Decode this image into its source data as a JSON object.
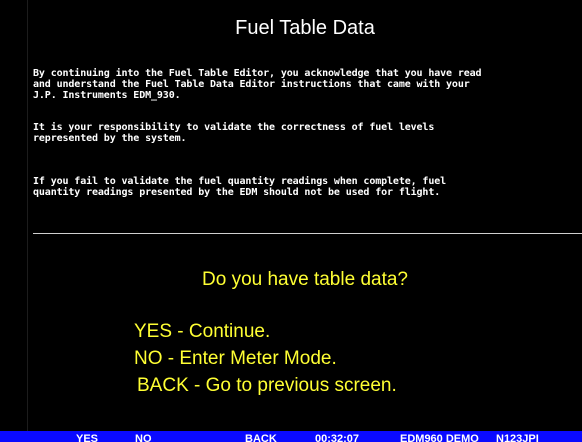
{
  "screen": {
    "title": "Fuel Table Data",
    "paragraphs": [
      "By continuing into the Fuel Table Editor, you acknowledge that you have read\nand understand the Fuel Table Data Editor instructions that came with your\nJ.P. Instruments EDM_930.",
      "It is your responsibility to validate the correctness of fuel levels\nrepresented by the system.",
      "If you fail to validate the fuel quantity readings when complete, fuel\nquantity readings presented by the EDM should not be used for flight."
    ],
    "question": "Do you have table data?",
    "options": [
      "YES - Continue.",
      "NO - Enter Meter Mode.",
      "BACK - Go to previous screen."
    ]
  },
  "softkeys": {
    "yes": "YES",
    "no": "NO",
    "back": "BACK",
    "time": "00:32:07",
    "model": "EDM960 DEMO",
    "tail": "N123JPI"
  },
  "colors": {
    "background": "#000000",
    "text": "#ffffff",
    "prompt": "#ffff33",
    "softkey_bar": "#0a0aff"
  }
}
